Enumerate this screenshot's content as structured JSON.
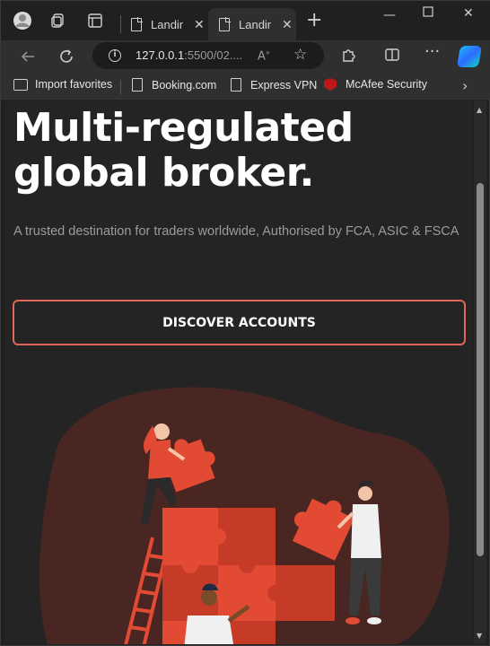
{
  "browser": {
    "tabs": [
      {
        "title": "Landin",
        "active": false
      },
      {
        "title": "Landin",
        "active": true
      }
    ],
    "address": {
      "host": "127.0.0.1",
      "path": ":5500/02...."
    },
    "favorites": [
      {
        "label": "Import favorites",
        "icon": "folder-icon"
      },
      {
        "label": "Booking.com",
        "icon": "page-icon"
      },
      {
        "label": "Express VPN",
        "icon": "page-icon"
      },
      {
        "label": "McAfee Security",
        "icon": "mcafee-icon"
      }
    ]
  },
  "page": {
    "hero_title": "Multi-regulated global broker.",
    "hero_subtitle": "A trusted destination for traders worldwide, Authorised by FCA, ASIC & FSCA",
    "cta_label": "DISCOVER ACCOUNTS"
  },
  "colors": {
    "page_bg": "#242424",
    "accent": "#e0665a",
    "puzzle_red": "#e24a33",
    "blob": "#4a2622"
  }
}
